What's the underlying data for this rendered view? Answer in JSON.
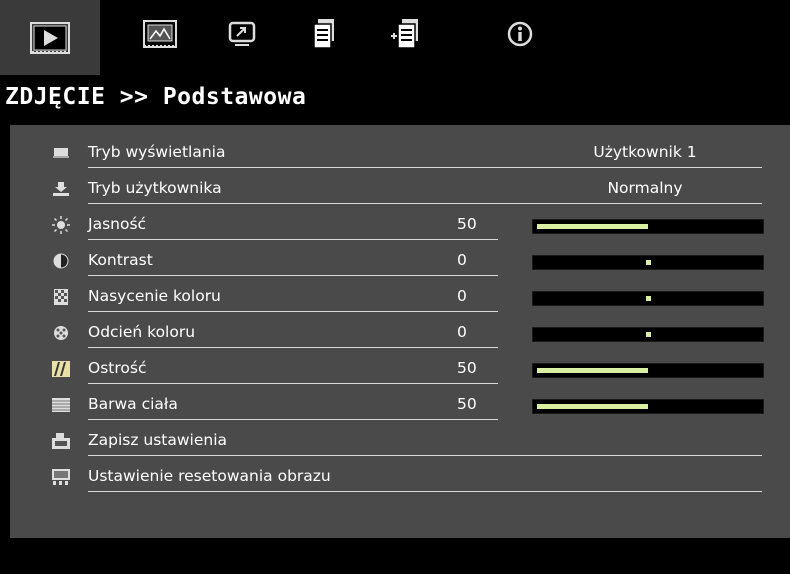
{
  "tabs": [
    {
      "icon": "picture-icon",
      "active": true
    },
    {
      "icon": "screen-icon",
      "active": false
    },
    {
      "icon": "display-icon",
      "active": false
    },
    {
      "icon": "settings-document-icon",
      "active": false
    },
    {
      "icon": "options-document-icon",
      "active": false
    },
    {
      "icon": "info-icon",
      "active": false
    }
  ],
  "header": {
    "title": "ZDJĘCIE >> Podstawowa"
  },
  "colors": {
    "accent": "#d8f0a0",
    "panel": "#4a4a4a",
    "active_tab": "#3a3a3a"
  },
  "menu": {
    "items": [
      {
        "label": "Tryb wyświetlania",
        "setting": "Użytkownik 1",
        "icon": "display-mode-icon"
      },
      {
        "label": "Tryb użytkownika",
        "setting": "Normalny",
        "icon": "user-mode-icon"
      },
      {
        "label": "Jasność",
        "value": "50",
        "level": 0.5,
        "icon": "brightness-icon"
      },
      {
        "label": "Kontrast",
        "value": "0",
        "level": 0.5,
        "icon": "contrast-icon"
      },
      {
        "label": "Nasycenie koloru",
        "value": "0",
        "level": 0.5,
        "icon": "saturation-icon"
      },
      {
        "label": "Odcień koloru",
        "value": "0",
        "level": 0.5,
        "icon": "tint-icon"
      },
      {
        "label": "Ostrość",
        "value": "50",
        "level": 0.5,
        "icon": "sharpness-icon"
      },
      {
        "label": "Barwa ciała",
        "value": "50",
        "level": 0.5,
        "icon": "skin-tone-icon"
      },
      {
        "label": "Zapisz ustawienia",
        "icon": "save-settings-icon"
      },
      {
        "label": "Ustawienie resetowania obrazu",
        "icon": "reset-image-icon"
      }
    ]
  }
}
